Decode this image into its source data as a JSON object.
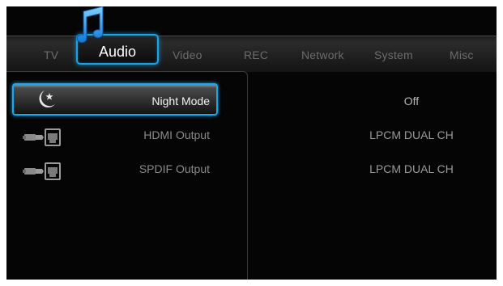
{
  "tabs": [
    {
      "label": "TV"
    },
    {
      "label": "Audio"
    },
    {
      "label": "Video"
    },
    {
      "label": "REC"
    },
    {
      "label": "Network"
    },
    {
      "label": "System"
    },
    {
      "label": "Misc"
    }
  ],
  "active_tab": "Audio",
  "settings": [
    {
      "label": "Night Mode",
      "value": "Off",
      "icon": "moon-star-icon",
      "selected": true
    },
    {
      "label": "HDMI Output",
      "value": "LPCM DUAL CH",
      "icon": "cable-connector-icon",
      "selected": false
    },
    {
      "label": "SPDIF Output",
      "value": "LPCM DUAL CH",
      "icon": "cable-connector-icon",
      "selected": false
    }
  ],
  "colors": {
    "highlight": "#18a3ea",
    "background": "#050505"
  }
}
